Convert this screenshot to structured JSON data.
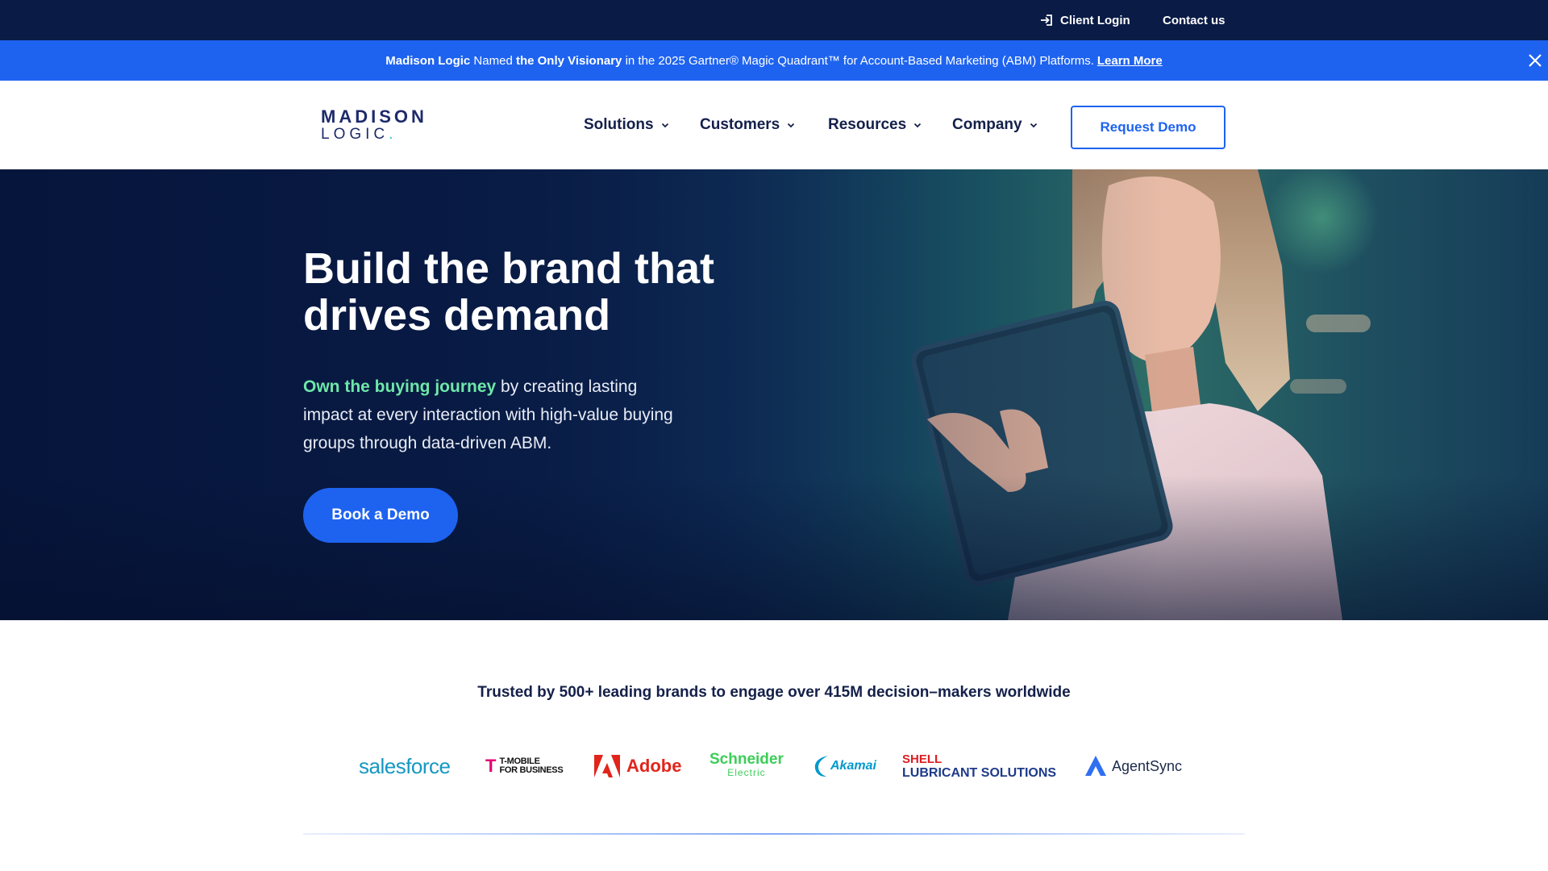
{
  "utility": {
    "client_login": "Client Login",
    "contact_us": "Contact us"
  },
  "announcement": {
    "brand": "Madison Logic",
    "named": " Named ",
    "only_visionary": "the Only Visionary",
    "rest": " in the 2025 Gartner® Magic Quadrant™ for Account-Based Marketing (ABM) Platforms.",
    "learn_more": "Learn More"
  },
  "header": {
    "logo_line1": "MADISON",
    "logo_line2": "LOGIC",
    "logo_dot": ".",
    "nav": [
      "Solutions",
      "Customers",
      "Resources",
      "Company"
    ],
    "request_demo": "Request Demo"
  },
  "hero": {
    "headline": "Build the brand that drives demand",
    "highlight": "Own the buying journey",
    "body": " by creating lasting impact at every interaction with high-value buying groups through data-driven ABM.",
    "cta": "Book a Demo"
  },
  "trusted": {
    "heading": "Trusted by 500+ leading brands to engage over 415M decision–makers worldwide",
    "brands": {
      "salesforce": "salesforce",
      "tmobile_1": "T-MOBILE",
      "tmobile_2": "FOR BUSINESS",
      "adobe": "Adobe",
      "schneider_1": "Schneider",
      "schneider_2": "Electric",
      "akamai": "Akamai",
      "shell_1": "SHELL",
      "shell_2": "LUBRICANT SOLUTIONS",
      "agentsync": "AgentSync"
    }
  },
  "colors": {
    "navy": "#0a1b45",
    "accent_blue": "#1e63f0",
    "highlight_green": "#6ee7a8",
    "text_dark": "#14204a"
  },
  "icons": {
    "client_login": "login-icon",
    "close": "close-icon",
    "nav_dropdown": "chevron-down-icon"
  }
}
